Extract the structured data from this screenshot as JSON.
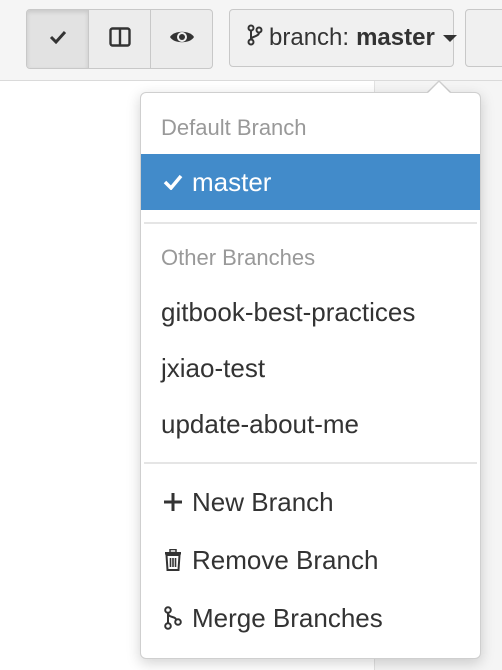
{
  "toolbar": {
    "buttons": [
      {
        "icon": "checkmark-icon"
      },
      {
        "icon": "split-view-icon"
      },
      {
        "icon": "eye-icon"
      }
    ],
    "branch_button": {
      "icon": "git-branch-icon",
      "prefix": "branch:",
      "current": "master"
    }
  },
  "dropdown": {
    "default_header": "Default Branch",
    "default_branch": "master",
    "other_header": "Other Branches",
    "other_branches": [
      "gitbook-best-practices",
      "jxiao-test",
      "update-about-me"
    ],
    "actions": [
      {
        "label": "New Branch",
        "icon": "plus-icon"
      },
      {
        "label": "Remove Branch",
        "icon": "trash-icon"
      },
      {
        "label": "Merge Branches",
        "icon": "merge-icon"
      }
    ]
  },
  "colors": {
    "selected_background": "#428bca",
    "header_text": "#999999",
    "toolbar_background": "#f5f5f5"
  }
}
